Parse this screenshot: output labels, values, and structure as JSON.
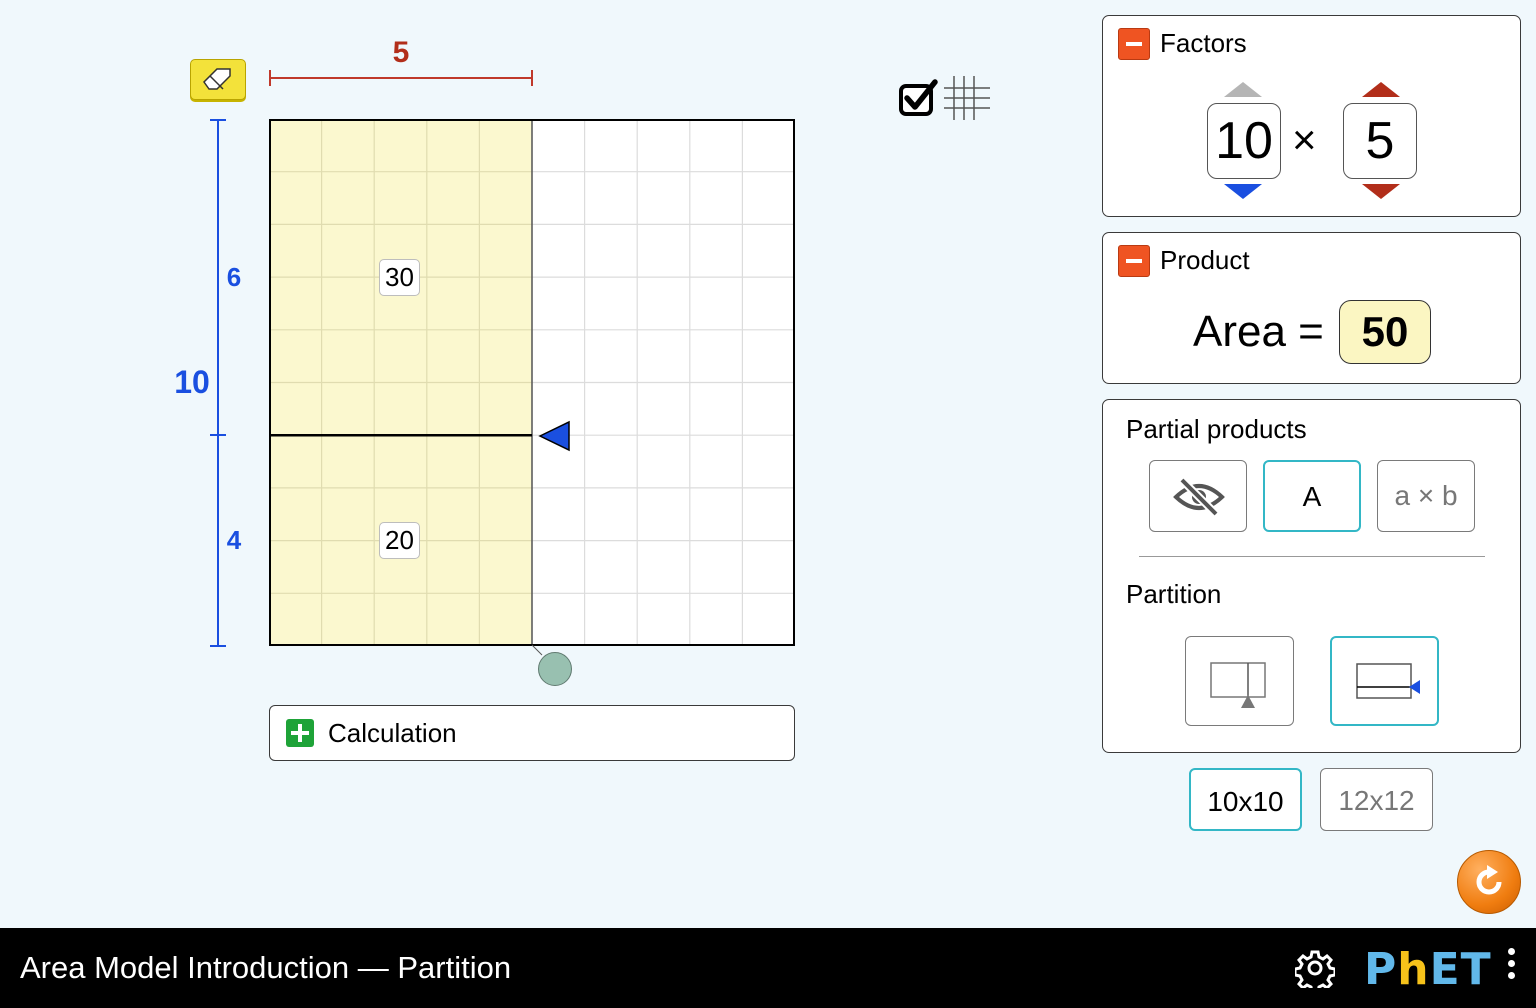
{
  "colors": {
    "background": "#f0f8fc",
    "horizontal_dimension": "#b22e1a",
    "vertical_dimension": "#1a4fe0",
    "selected_region_fill": "#fbf8cf",
    "selected_border": "#33b7c6",
    "minus_button": "#ef5422",
    "plus_button": "#1ea338",
    "reset_button": "#f07d10",
    "navbar": "#000000"
  },
  "toolbar": {
    "eraser_icon": "eraser-icon",
    "grid_checkbox_checked": true,
    "grid_icon": "grid-icon"
  },
  "area_model": {
    "width_label": "5",
    "height_total_label": "10",
    "height_partition_top": "6",
    "height_partition_bottom": "4",
    "partial_product_top": "30",
    "partial_product_bottom": "20",
    "grid_columns": 10,
    "grid_rows": 10
  },
  "calculation": {
    "label": "Calculation",
    "expanded": false
  },
  "factors": {
    "title": "Factors",
    "first": "10",
    "operator": "×",
    "second": "5"
  },
  "product": {
    "title": "Product",
    "area_label": "Area =",
    "area_value": "50"
  },
  "partial_products": {
    "title": "Partial products",
    "options": [
      "hidden",
      "A",
      "a × b"
    ],
    "selected": "A",
    "label_A": "A",
    "label_ab": "a × b"
  },
  "partition": {
    "title": "Partition",
    "options": [
      "vertical",
      "horizontal"
    ],
    "selected": "horizontal"
  },
  "grid_size": {
    "options": [
      "10x10",
      "12x12"
    ],
    "selected": "10x10",
    "option_1": "10x10",
    "option_2": "12x12"
  },
  "navbar": {
    "title": "Area Model Introduction — Partition",
    "logo_text_1": "P",
    "logo_text_2": "h",
    "logo_text_3": "ET"
  }
}
